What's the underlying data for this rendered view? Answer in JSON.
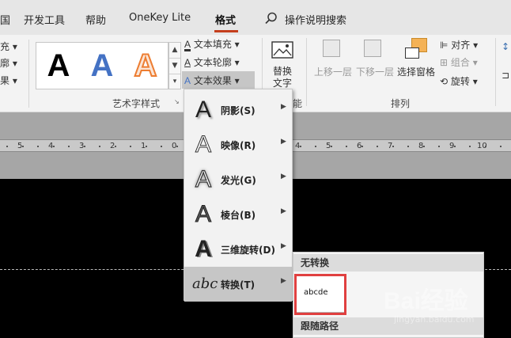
{
  "tabs": [
    {
      "label": "开发工具"
    },
    {
      "label": "帮助"
    },
    {
      "label": "OneKey Lite"
    },
    {
      "label": "格式"
    }
  ],
  "search": {
    "label": "操作说明搜索"
  },
  "ribbon": {
    "left_cut": [
      "充 ▾",
      "廓 ▾",
      "果 ▾"
    ],
    "wordart_styles": {
      "thumb_letter": "A",
      "group_label": "艺术字样式"
    },
    "text_fill": "文本填充",
    "text_outline": "文本轮廓",
    "text_effects": "文本效果",
    "alt_text_line1": "替换",
    "alt_text_line2": "文字",
    "accessibility_cut": "能",
    "bring_forward": "上移一层",
    "send_backward": "下移一层",
    "selection_pane": "选择窗格",
    "align": "对齐",
    "group": "组合",
    "rotate": "旋转",
    "arrange_label": "排列"
  },
  "ruler": {
    "labels": [
      "5",
      "4",
      "3",
      "2",
      "1",
      "0",
      "1",
      "2",
      "3",
      "4",
      "5"
    ]
  },
  "text_effects_menu": {
    "items": [
      {
        "label": "阴影(S)",
        "icon": "shadow-A-icon"
      },
      {
        "label": "映像(R)",
        "icon": "reflection-A-icon"
      },
      {
        "label": "发光(G)",
        "icon": "glow-A-icon"
      },
      {
        "label": "棱台(B)",
        "icon": "bevel-A-icon"
      },
      {
        "label": "三维旋转(D)",
        "icon": "3d-rotation-A-icon"
      },
      {
        "label": "转换(T)",
        "icon": "transform-abc-icon"
      }
    ],
    "icon_letter": "A",
    "transform_icon_text": "abc"
  },
  "transform_submenu": {
    "no_transform": "无转换",
    "sample_text": "abcde",
    "follow_path": "跟随路径"
  },
  "watermark": {
    "brand": "Bai经验",
    "url": "jingyan.baidu.com"
  },
  "colors": {
    "accent_tab": "#c43e1c",
    "highlight_box": "#e04040",
    "menu_selected": "#c6c6c6"
  }
}
